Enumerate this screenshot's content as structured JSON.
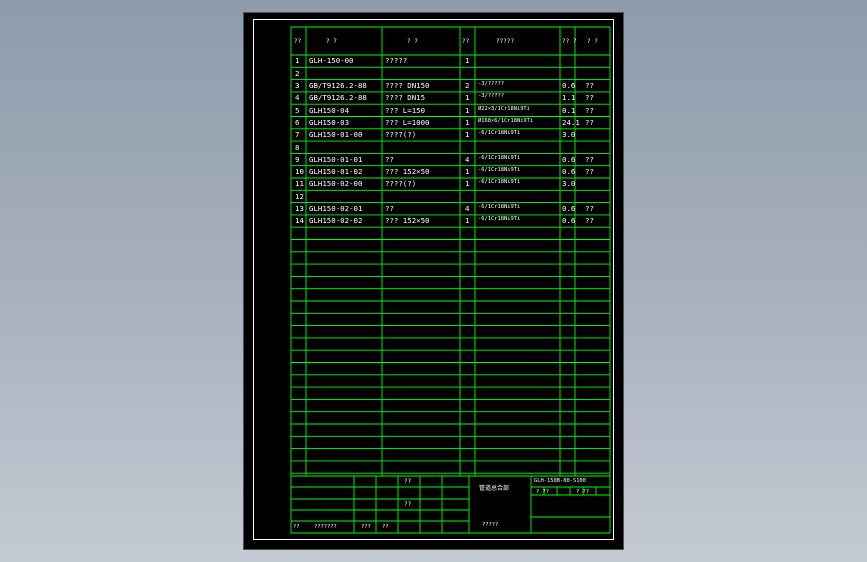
{
  "colors": {
    "background_top": "#8e9bab",
    "sheet": "#000000",
    "lines": "#00ff00",
    "text": "#ffffff",
    "frame": "#ffffff"
  },
  "header": {
    "seq": "??",
    "code": "?  ?",
    "name": "?  ?",
    "qty": "??",
    "material": "?????",
    "unit_wt": "??\n?",
    "remark": "?  ?"
  },
  "rows": [
    {
      "seq": "1",
      "code": "GLH-150-00",
      "name": "?????",
      "qty": "1",
      "material": "",
      "weight": "",
      "remark": ""
    },
    {
      "seq": "2",
      "code": "",
      "name": "",
      "qty": "",
      "material": "",
      "weight": "",
      "remark": ""
    },
    {
      "seq": "3",
      "code": "GB/T9126.2-88",
      "name": "???? DN150",
      "qty": "2",
      "material": "-3/?????",
      "weight": "0.6",
      "remark": "??"
    },
    {
      "seq": "4",
      "code": "GB/T9126.2-88",
      "name": "???? DN15",
      "qty": "1",
      "material": "-3/?????",
      "weight": "1.1",
      "remark": "??"
    },
    {
      "seq": "5",
      "code": "GLH150-04",
      "name": "??? L=150",
      "qty": "1",
      "material": "Ø22×3/1Cr18Ni9Ti",
      "weight": "0.1",
      "remark": "??"
    },
    {
      "seq": "6",
      "code": "GLH150-03",
      "name": "??? L=1000",
      "qty": "1",
      "material": "Ø168×6/1Cr18Ni9Ti",
      "weight": "24.1",
      "remark": "??"
    },
    {
      "seq": "7",
      "code": "GLH150-01-00",
      "name": "????(?)",
      "qty": "1",
      "material": "-6/1Cr18Ni9Ti",
      "weight": "3.0",
      "remark": ""
    },
    {
      "seq": "8",
      "code": "",
      "name": "",
      "qty": "",
      "material": "",
      "weight": "",
      "remark": ""
    },
    {
      "seq": "9",
      "code": "GLH150-01-01",
      "name": "??",
      "qty": "4",
      "material": "-6/1Cr18Ni9Ti",
      "weight": "0.6",
      "remark": "??"
    },
    {
      "seq": "10",
      "code": "GLH150-01-02",
      "name": "???  152×50",
      "qty": "1",
      "material": "-6/1Cr18Ni9Ti",
      "weight": "0.6",
      "remark": "??"
    },
    {
      "seq": "11",
      "code": "GLH150-02-00",
      "name": "????(?)",
      "qty": "1",
      "material": "-6/1Cr18Ni9Ti",
      "weight": "3.0",
      "remark": ""
    },
    {
      "seq": "12",
      "code": "",
      "name": "",
      "qty": "",
      "material": "",
      "weight": "",
      "remark": ""
    },
    {
      "seq": "13",
      "code": "GLH150-02-01",
      "name": "??",
      "qty": "4",
      "material": "-6/1Cr18Ni9Ti",
      "weight": "0.6",
      "remark": "??"
    },
    {
      "seq": "14",
      "code": "GLH150-02-02",
      "name": "???  152×50",
      "qty": "1",
      "material": "-6/1Cr18Ni9Ti",
      "weight": "0.6",
      "remark": "??"
    }
  ],
  "title_block": {
    "cell_a": "??",
    "cell_b": "??",
    "drawing_title": "管道总合部",
    "drawing_number": "GLH-150B-00-S100",
    "sheet_left": "?  ??",
    "sheet_right": "?  ??",
    "company": "?????",
    "sign_label": "??",
    "sign_value": "???????",
    "date_label": "???",
    "date_value": "??"
  }
}
